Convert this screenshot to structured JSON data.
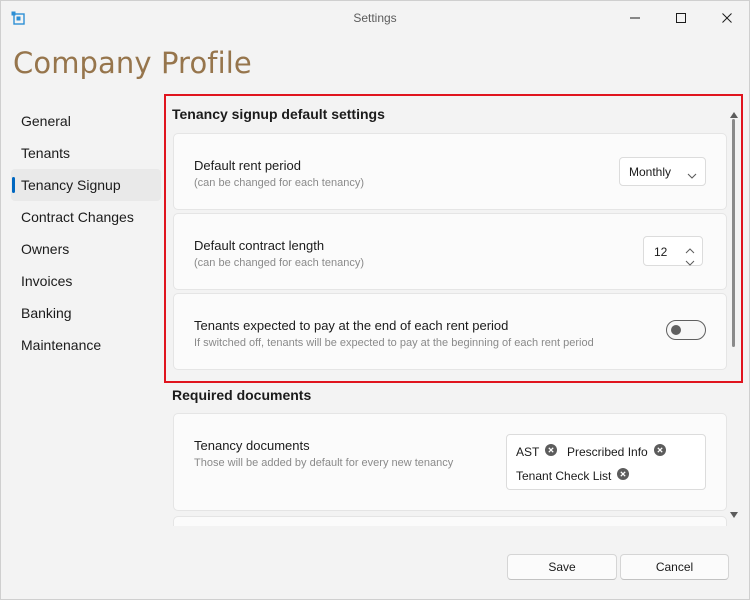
{
  "window": {
    "title": "Settings"
  },
  "page": {
    "title": "Company Profile"
  },
  "sidebar": {
    "items": [
      {
        "label": "General",
        "selected": false
      },
      {
        "label": "Tenants",
        "selected": false
      },
      {
        "label": "Tenancy Signup",
        "selected": true
      },
      {
        "label": "Contract Changes",
        "selected": false
      },
      {
        "label": "Owners",
        "selected": false
      },
      {
        "label": "Invoices",
        "selected": false
      },
      {
        "label": "Banking",
        "selected": false
      },
      {
        "label": "Maintenance",
        "selected": false
      }
    ]
  },
  "tenancy_signup": {
    "title": "Tenancy signup default settings",
    "rent_period": {
      "label": "Default rent period",
      "sub": "(can be changed for each tenancy)",
      "value": "Monthly"
    },
    "contract_length": {
      "label": "Default contract length",
      "sub": "(can be changed for each tenancy)",
      "value": "12"
    },
    "pay_at_end": {
      "label": "Tenants expected to pay at the end of each rent period",
      "sub": "If switched off, tenants will be expected to pay at the beginning of each rent period",
      "checked": false
    }
  },
  "required_documents": {
    "title": "Required documents",
    "tenancy_documents": {
      "label": "Tenancy documents",
      "sub": "Those will be added by default for every new tenancy",
      "tags": [
        "AST",
        "Prescribed Info",
        "Tenant Check List"
      ]
    }
  },
  "footer": {
    "save_label": "Save",
    "cancel_label": "Cancel"
  },
  "colors": {
    "accent": "#0067c0",
    "title": "#96754c",
    "highlight": "#e0141e"
  }
}
